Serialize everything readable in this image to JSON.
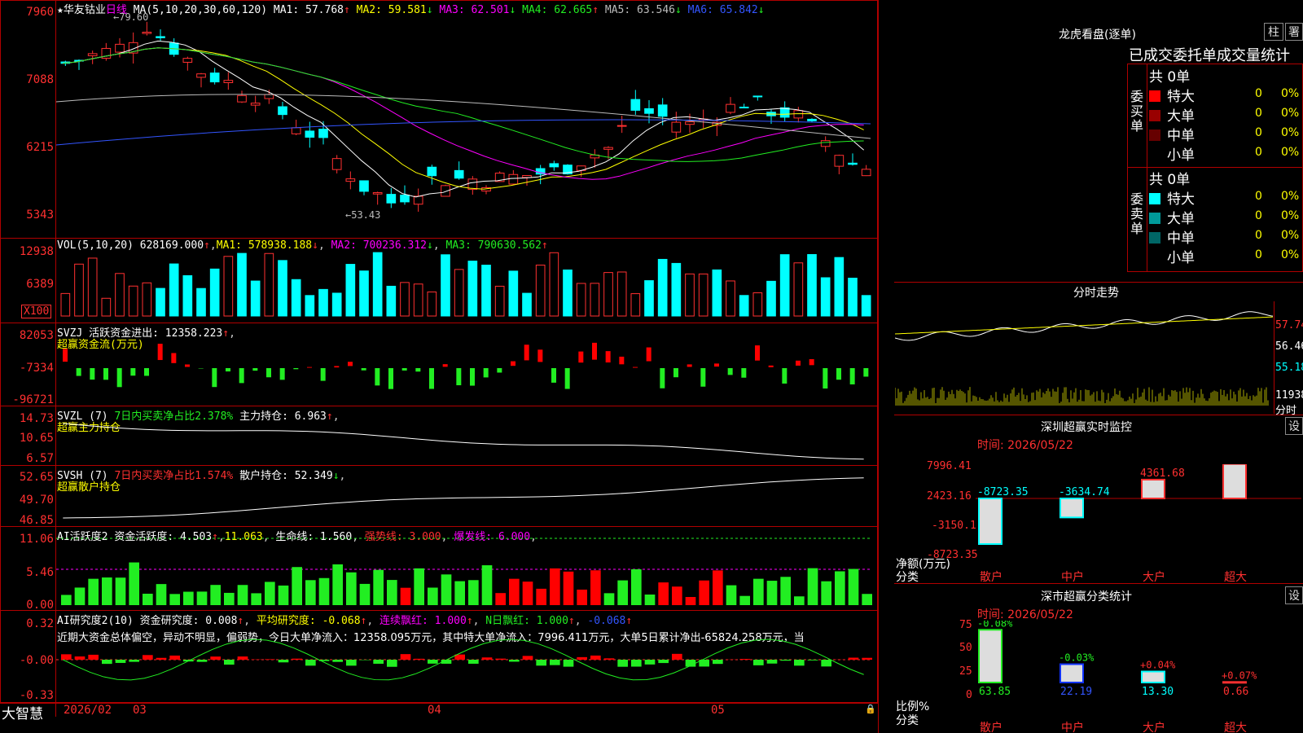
{
  "stock": {
    "name": "华友钴业",
    "period": "日线",
    "star": "★"
  },
  "main": {
    "ma_label": "MA(5,10,20,30,60,120)",
    "ma": [
      {
        "k": "MA1:",
        "v": "57.768",
        "a": "↑",
        "c": "#ffffff"
      },
      {
        "k": "MA2:",
        "v": "59.581",
        "a": "↓",
        "c": "#ffff00"
      },
      {
        "k": "MA3:",
        "v": "62.501",
        "a": "↓",
        "c": "#ff00ff"
      },
      {
        "k": "MA4:",
        "v": "62.665",
        "a": "↑",
        "c": "#22ee22"
      },
      {
        "k": "MA5:",
        "v": "63.546",
        "a": "↓",
        "c": "#bbbbbb"
      },
      {
        "k": "MA6:",
        "v": "65.842",
        "a": "↓",
        "c": "#3355ff"
      }
    ],
    "yaxis": [
      "7960",
      "7088",
      "6215",
      "5343"
    ],
    "high_mark": "79.60",
    "low_mark": "53.43"
  },
  "vol": {
    "header": "VOL(5,10,20)",
    "value": "628169.000",
    "arrow": "↑",
    "ma1": "578938.188",
    "ma2": "700236.312",
    "ma3": "790630.562",
    "yaxis": [
      "12938",
      "6389"
    ],
    "unit": "X100"
  },
  "svzj": {
    "header": "SVZJ  活跃资金进出:",
    "value": "12358.223",
    "arrow": "↑",
    "sub": "超赢资金流(万元)",
    "yaxis": [
      "82053",
      "-7334",
      "-96721"
    ]
  },
  "svzl": {
    "header": "SVZL (7)",
    "stat": "7日内买卖净占比2.378%",
    "label": "主力持仓:",
    "value": "6.963",
    "arrow": "↑",
    "sub": "超赢主力持仓",
    "yaxis": [
      "14.73",
      "10.65",
      "6.57"
    ]
  },
  "svsh": {
    "header": "SVSH (7)",
    "stat": "7日内买卖净占比1.574%",
    "label": "散户持仓:",
    "value": "52.349",
    "arrow": "↓",
    "sub": "超赢散户持仓",
    "yaxis": [
      "52.65",
      "49.70",
      "46.85"
    ]
  },
  "ai1": {
    "header": "AI活跃度2",
    "a_label": "资金活跃度:",
    "a_val": "4.503",
    "b_val": "11.063",
    "c_label": "生命线:",
    "c_val": "1.560",
    "d_label": "强势线:",
    "d_val": "3.000",
    "e_label": "爆发线:",
    "e_val": "6.000",
    "yaxis": [
      "11.06",
      "5.46",
      "0.00"
    ]
  },
  "ai2": {
    "header": "AI研究度2(10)",
    "a_label": "资金研究度:",
    "a_val": "0.008",
    "b_label": "平均研究度:",
    "b_val": "-0.068",
    "c_label": "连续飘红:",
    "c_val": "1.000",
    "d_label": "N日飘红:",
    "d_val": "1.000",
    "e_val": "-0.068",
    "text": "近期大资金总体偏空，异动不明显，偏弱势，今日大单净流入：12358.095万元，其中特大单净流入：7996.411万元，大单5日累计净出-65824.258万元，当",
    "yaxis": [
      "0.32",
      "-0.00",
      "-0.33"
    ]
  },
  "xaxis": {
    "year": "2026/02",
    "m1": "03",
    "m2": "04",
    "m3": "05"
  },
  "logo": "大智慧",
  "lhb": {
    "title": "龙虎看盘(逐单)",
    "btn1": "柱",
    "btn2": "署",
    "subtitle": "已成交委托单成交量统计",
    "buy": {
      "side": "委买单",
      "total": "共 0单",
      "rows": [
        {
          "n": "特大",
          "c": "#ff0000",
          "v": "0",
          "p": "0%"
        },
        {
          "n": "大单",
          "c": "#990000",
          "v": "0",
          "p": "0%"
        },
        {
          "n": "中单",
          "c": "#660000",
          "v": "0",
          "p": "0%"
        },
        {
          "n": "小单",
          "c": "#000000",
          "v": "0",
          "p": "0%"
        }
      ]
    },
    "sell": {
      "side": "委卖单",
      "total": "共 0单",
      "rows": [
        {
          "n": "特大",
          "c": "#00ffff",
          "v": "0",
          "p": "0%"
        },
        {
          "n": "大单",
          "c": "#009999",
          "v": "0",
          "p": "0%"
        },
        {
          "n": "中单",
          "c": "#006666",
          "v": "0",
          "p": "0%"
        },
        {
          "n": "小单",
          "c": "#000000",
          "v": "0",
          "p": "0%"
        }
      ]
    }
  },
  "fenshi": {
    "title": "分时走势",
    "y1": "57.74",
    "y2": "56.46",
    "y3": "55.18",
    "vol": "11938",
    "vol2": "分时"
  },
  "monitor": {
    "title": "深圳超赢实时监控",
    "btn": "设",
    "time": "时间: 2026/05/22",
    "yaxis": [
      "7996.41",
      "2423.16",
      "-3150.1",
      "-8723.35"
    ],
    "ylabel": "净额(万元)",
    "xlabel": "分类",
    "cats": [
      "散户",
      "中户",
      "大户",
      "超大"
    ]
  },
  "stats": {
    "title": "深市超赢分类统计",
    "btn": "设",
    "time": "时间: 2026/05/22",
    "yaxis": [
      "75",
      "50",
      "25",
      "0"
    ],
    "ylabel": "比例%",
    "xlabel": "分类",
    "cats": [
      "散户",
      "中户",
      "大户",
      "超大"
    ]
  },
  "chart_data": [
    {
      "type": "bar",
      "title": "深圳超赢实时监控",
      "ylabel": "净额(万元)",
      "xlabel": "分类",
      "categories": [
        "散户",
        "中户",
        "大户",
        "超大"
      ],
      "values": [
        -8723.35,
        -3634.74,
        4361.68,
        7996.41
      ],
      "ylim": [
        -8723.35,
        7996.41
      ]
    },
    {
      "type": "bar",
      "title": "深市超赢分类统计",
      "ylabel": "比例%",
      "xlabel": "分类",
      "categories": [
        "散户",
        "中户",
        "大户",
        "超大"
      ],
      "values": [
        63.85,
        22.19,
        13.3,
        0.66
      ],
      "changes": [
        "-0.08%",
        "-0.03%",
        "+0.04%",
        "+0.07%"
      ],
      "ylim": [
        0,
        75
      ]
    }
  ]
}
